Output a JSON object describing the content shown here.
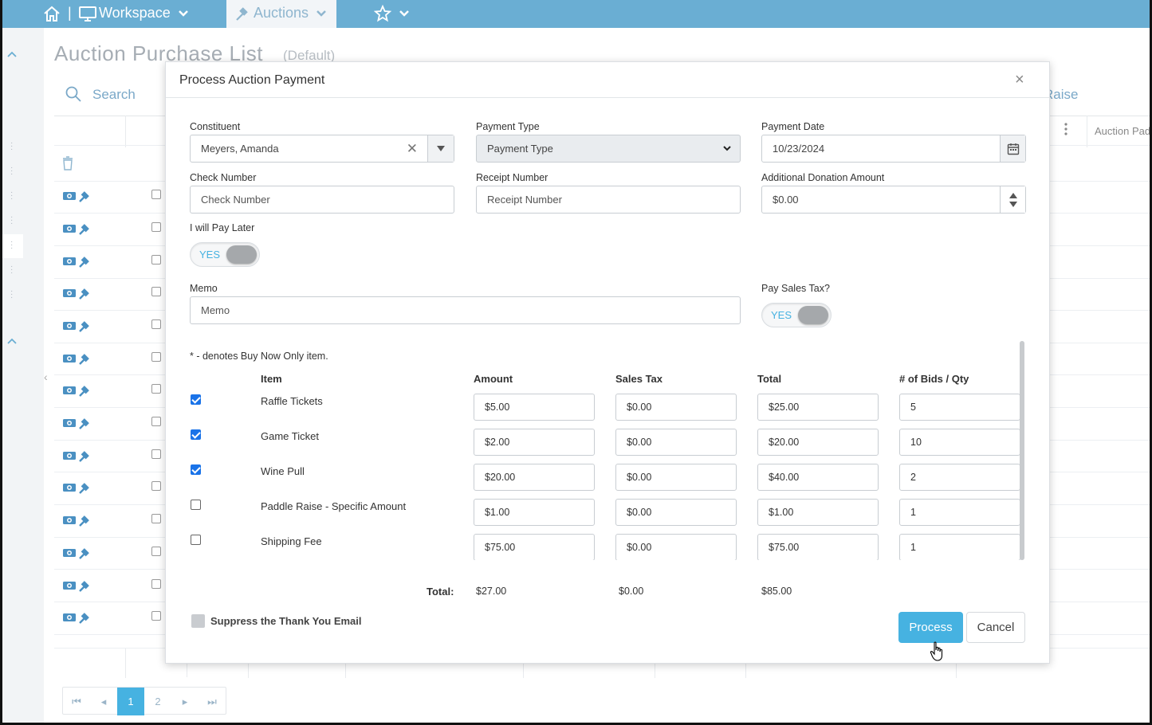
{
  "topbar": {
    "workspace_label": "Workspace",
    "auctions_label": "Auctions"
  },
  "background": {
    "page_title": "Auction Purchase List",
    "page_subtitle": "(Default)",
    "search_label": "Search",
    "raise_label": "Raise",
    "column_header": "Auction Pad",
    "pager": [
      "1",
      "2"
    ],
    "pager_active": "1"
  },
  "modal": {
    "title": "Process Auction Payment",
    "close_glyph": "×",
    "fields": {
      "constituent_label": "Constituent",
      "constituent_value": "Meyers, Amanda",
      "payment_type_label": "Payment Type",
      "payment_type_value": "Payment Type",
      "payment_date_label": "Payment Date",
      "payment_date_value": "10/23/2024",
      "check_number_label": "Check Number",
      "check_number_placeholder": "Check Number",
      "receipt_number_label": "Receipt Number",
      "receipt_number_placeholder": "Receipt Number",
      "additional_donation_label": "Additional Donation Amount",
      "additional_donation_value": "$0.00",
      "pay_later_label": "I will Pay Later",
      "pay_later_toggle": "YES",
      "memo_label": "Memo",
      "memo_placeholder": "Memo",
      "sales_tax_label": "Pay Sales Tax?",
      "sales_tax_toggle": "YES"
    },
    "items_note": "* - denotes Buy Now Only item.",
    "columns": {
      "item": "Item",
      "amount": "Amount",
      "sales_tax": "Sales Tax",
      "total": "Total",
      "bids_qty": "# of Bids / Qty"
    },
    "items": [
      {
        "checked": true,
        "name": "Raffle Tickets",
        "amount": "$5.00",
        "sales_tax": "$0.00",
        "total": "$25.00",
        "qty": "5"
      },
      {
        "checked": true,
        "name": "Game Ticket",
        "amount": "$2.00",
        "sales_tax": "$0.00",
        "total": "$20.00",
        "qty": "10"
      },
      {
        "checked": true,
        "name": "Wine Pull",
        "amount": "$20.00",
        "sales_tax": "$0.00",
        "total": "$40.00",
        "qty": "2"
      },
      {
        "checked": false,
        "name": "Paddle Raise - Specific Amount",
        "amount": "$1.00",
        "sales_tax": "$0.00",
        "total": "$1.00",
        "qty": "1"
      },
      {
        "checked": false,
        "name": "Shipping Fee",
        "amount": "$75.00",
        "sales_tax": "$0.00",
        "total": "$75.00",
        "qty": "1"
      }
    ],
    "totals": {
      "label": "Total:",
      "amount": "$27.00",
      "sales_tax": "$0.00",
      "total": "$85.00"
    },
    "suppress_label": "Suppress the Thank You Email",
    "process_label": "Process",
    "cancel_label": "Cancel"
  },
  "colors": {
    "topbar": "#6aaed3",
    "accent": "#46b2e1",
    "checkbox_on": "#1a73e8"
  }
}
